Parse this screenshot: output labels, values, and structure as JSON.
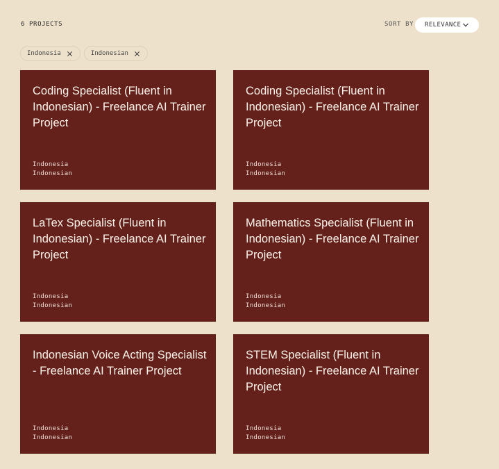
{
  "header": {
    "count_label": "6 PROJECTS",
    "sort_label": "SORT BY",
    "sort_value": "RELEVANCE"
  },
  "filters": [
    {
      "label": "Indonesia"
    },
    {
      "label": "Indonesian"
    }
  ],
  "projects": [
    {
      "title": "Coding Specialist (Fluent in Indonesian) - Freelance AI Trainer Project",
      "country": "Indonesia",
      "language": "Indonesian"
    },
    {
      "title": "Coding Specialist (Fluent in Indonesian) - Freelance AI Trainer Project",
      "country": "Indonesia",
      "language": "Indonesian"
    },
    {
      "title": "LaTex Specialist (Fluent in Indonesian) - Freelance AI Trainer Project",
      "country": "Indonesia",
      "language": "Indonesian"
    },
    {
      "title": "Mathematics Specialist (Fluent in Indonesian) - Freelance AI Trainer Project",
      "country": "Indonesia",
      "language": "Indonesian"
    },
    {
      "title": "Indonesian Voice Acting Specialist - Freelance AI Trainer Project",
      "country": "Indonesia",
      "language": "Indonesian"
    },
    {
      "title": "STEM Specialist (Fluent in Indonesian) - Freelance AI Trainer Project",
      "country": "Indonesia",
      "language": "Indonesian"
    }
  ],
  "colors": {
    "background": "#ede1cb",
    "card": "#64211b",
    "card_text": "#fbf3ea"
  }
}
